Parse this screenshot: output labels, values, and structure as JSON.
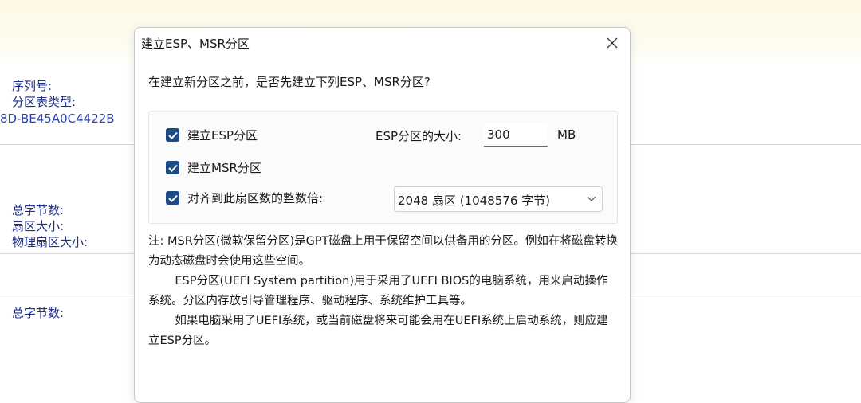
{
  "background": {
    "serial_label": "序列号:",
    "partition_table_label": "分区表类型:",
    "guid_value": "8D-BE45A0C4422B",
    "total_bytes_label": "总字节数:",
    "sector_size_label": "扇区大小:",
    "physical_sector_label": "物理扇区大小:",
    "total_bytes_label_2": "总字节数:"
  },
  "dialog": {
    "title": "建立ESP、MSR分区",
    "prompt": "在建立新分区之前，是否先建立下列ESP、MSR分区?",
    "options": {
      "create_esp": {
        "label": "建立ESP分区",
        "checked": true
      },
      "create_msr": {
        "label": "建立MSR分区",
        "checked": true
      },
      "align": {
        "label": "对齐到此扇区数的整数倍:",
        "checked": true
      }
    },
    "esp_size": {
      "label": "ESP分区的大小:",
      "value": "300",
      "unit": "MB"
    },
    "alignment_select": {
      "value": "2048 扇区 (1048576 字节)"
    },
    "note": {
      "para1": "注: MSR分区(微软保留分区)是GPT磁盘上用于保留空间以供备用的分区。例如在将磁盘转换为动态磁盘时会使用这些空间。",
      "para2": "ESP分区(UEFI System partition)用于采用了UEFI BIOS的电脑系统，用来启动操作系统。分区内存放引导管理程序、驱动程序、系统维护工具等。",
      "para3": "如果电脑采用了UEFI系统，或当前磁盘将来可能会用在UEFI系统上启动系统，则应建立ESP分区。"
    }
  },
  "colors": {
    "checkbox_fill": "#1d4b86",
    "background_label_text": "#1f2f8a"
  }
}
